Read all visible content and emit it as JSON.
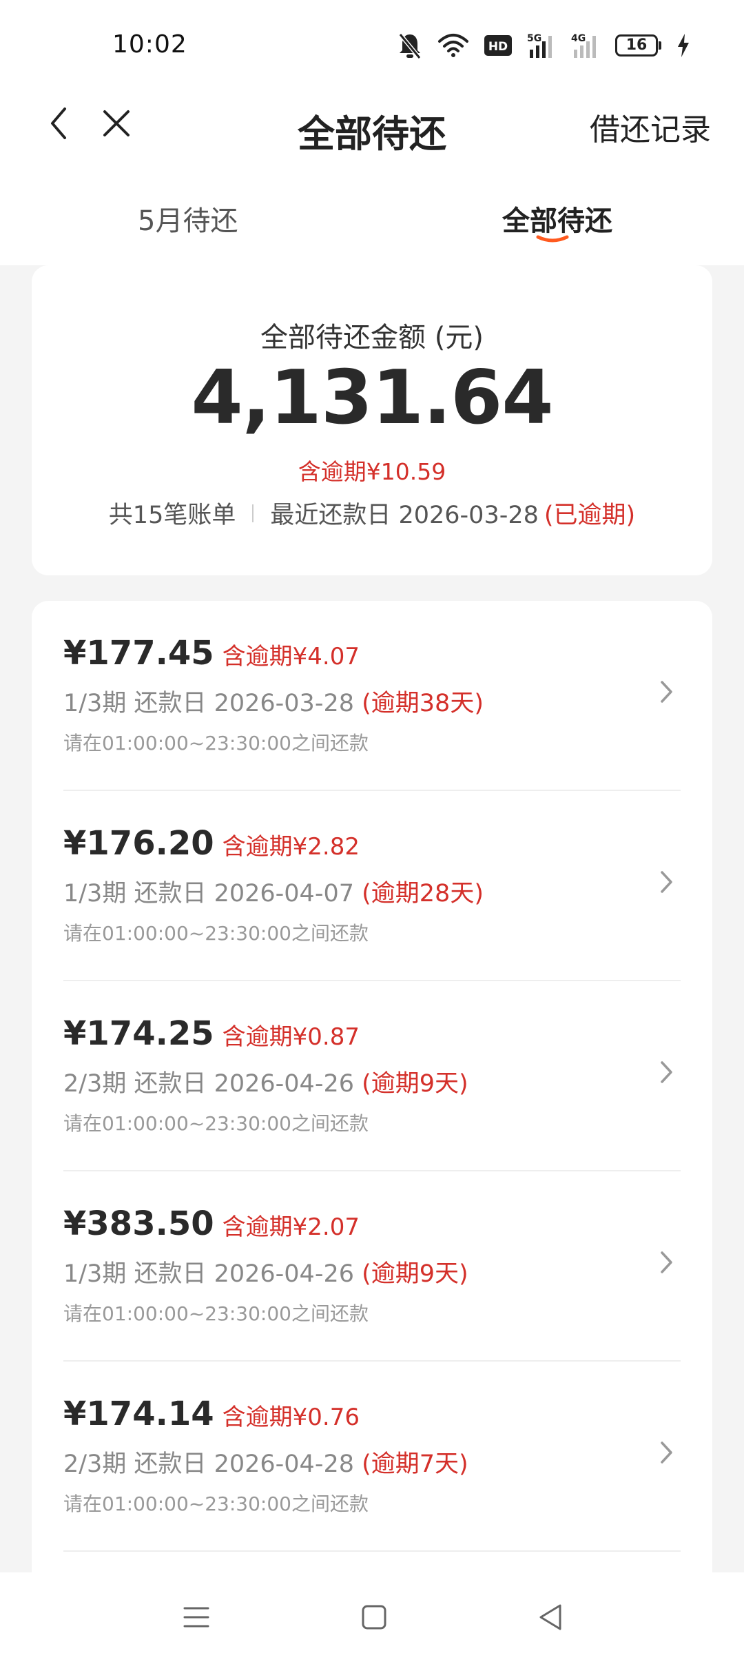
{
  "status_bar": {
    "time": "10:02",
    "battery_level": "16",
    "signal_1": "5G",
    "signal_2": "4G",
    "hd_badge": "HD",
    "icons": [
      "bell-muted-icon",
      "wifi-icon",
      "hd-icon",
      "signal-5g-icon",
      "signal-4g-icon",
      "battery-icon",
      "charging-icon"
    ]
  },
  "header": {
    "title": "全部待还",
    "history_link": "借还记录"
  },
  "tabs": [
    {
      "label": "5月待还",
      "active": false
    },
    {
      "label": "全部待还",
      "active": true
    }
  ],
  "summary": {
    "label": "全部待还金额 (元)",
    "amount": "4,131.64",
    "overdue": "含逾期¥10.59",
    "bill_count": "共15笔账单",
    "recent_due": "最近还款日 2026-03-28",
    "recent_status": "(已逾期)"
  },
  "bills": [
    {
      "amount": "¥177.45",
      "overdue": "含逾期¥4.07",
      "period_due": "1/3期 还款日 2026-03-28",
      "overdue_days": "(逾期38天)",
      "note": "请在01:00:00~23:30:00之间还款"
    },
    {
      "amount": "¥176.20",
      "overdue": "含逾期¥2.82",
      "period_due": "1/3期 还款日 2026-04-07",
      "overdue_days": "(逾期28天)",
      "note": "请在01:00:00~23:30:00之间还款"
    },
    {
      "amount": "¥174.25",
      "overdue": "含逾期¥0.87",
      "period_due": "2/3期 还款日 2026-04-26",
      "overdue_days": "(逾期9天)",
      "note": "请在01:00:00~23:30:00之间还款"
    },
    {
      "amount": "¥383.50",
      "overdue": "含逾期¥2.07",
      "period_due": "1/3期 还款日 2026-04-26",
      "overdue_days": "(逾期9天)",
      "note": "请在01:00:00~23:30:00之间还款"
    },
    {
      "amount": "¥174.14",
      "overdue": "含逾期¥0.76",
      "period_due": "2/3期 还款日 2026-04-28",
      "overdue_days": "(逾期7天)",
      "note": "请在01:00:00~23:30:00之间还款"
    }
  ],
  "colors": {
    "accent": "#ff5a1f",
    "overdue_red": "#d4302a",
    "text_dark": "#222222",
    "background": "#f4f4f4"
  }
}
